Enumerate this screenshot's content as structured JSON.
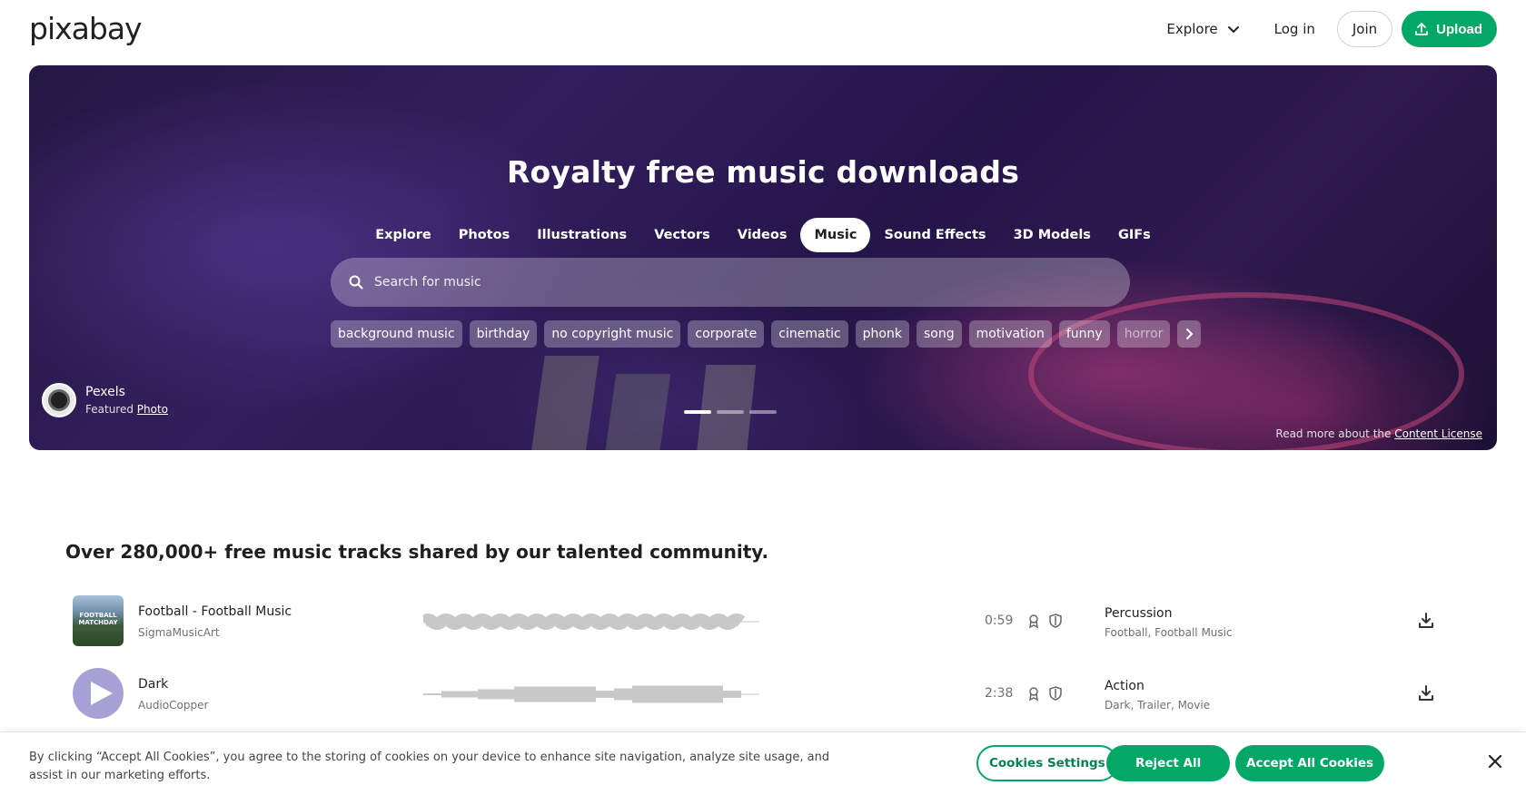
{
  "header": {
    "logo": "pixabay",
    "explore_label": "Explore",
    "login_label": "Log in",
    "join_label": "Join",
    "upload_label": "Upload"
  },
  "hero": {
    "title": "Royalty free music downloads",
    "tabs": [
      {
        "label": "Explore",
        "active": false
      },
      {
        "label": "Photos",
        "active": false
      },
      {
        "label": "Illustrations",
        "active": false
      },
      {
        "label": "Vectors",
        "active": false
      },
      {
        "label": "Videos",
        "active": false
      },
      {
        "label": "Music",
        "active": true
      },
      {
        "label": "Sound Effects",
        "active": false
      },
      {
        "label": "3D Models",
        "active": false
      },
      {
        "label": "GIFs",
        "active": false
      }
    ],
    "search": {
      "placeholder": "Search for music"
    },
    "chips": [
      "background music",
      "birthday",
      "no copyright music",
      "corporate",
      "cinematic",
      "phonk",
      "song",
      "motivation",
      "funny",
      "horror"
    ],
    "credit": {
      "name": "Pexels",
      "featured_prefix": "Featured",
      "featured_link": "Photo"
    },
    "license": {
      "prefix": "Read more about the",
      "link": "Content License"
    },
    "slide_count": 3,
    "active_slide": 1
  },
  "main": {
    "heading": "Over 280,000+ free music tracks shared by our talented community.",
    "tracks": [
      {
        "title": "Football - Football Music",
        "artist": "SigmaMusicArt",
        "cover_text": "FOOTBALL MATCHDAY",
        "duration": "0:59",
        "genre": "Percussion",
        "tags": "Football, Football Music"
      },
      {
        "title": "Dark",
        "artist": "AudioCopper",
        "duration": "2:38",
        "genre": "Action",
        "tags": "Dark, Trailer, Movie"
      }
    ]
  },
  "cookie": {
    "text": "By clicking “Accept All Cookies”, you agree to the storing of cookies on your device to enhance site navigation, analyze site usage, and assist in our marketing efforts.",
    "settings_label": "Cookies Settings",
    "reject_label": "Reject All",
    "accept_label": "Accept All Cookies"
  },
  "colors": {
    "brand_green": "#03a866",
    "text_dark": "#1f1f1f",
    "text_muted": "#707070"
  },
  "icons": [
    "chevron-down-icon",
    "upload-icon",
    "search-icon",
    "chevron-right-icon",
    "play-icon",
    "waveform-icon",
    "content-id-icon",
    "shield-icon",
    "download-icon",
    "close-icon"
  ]
}
